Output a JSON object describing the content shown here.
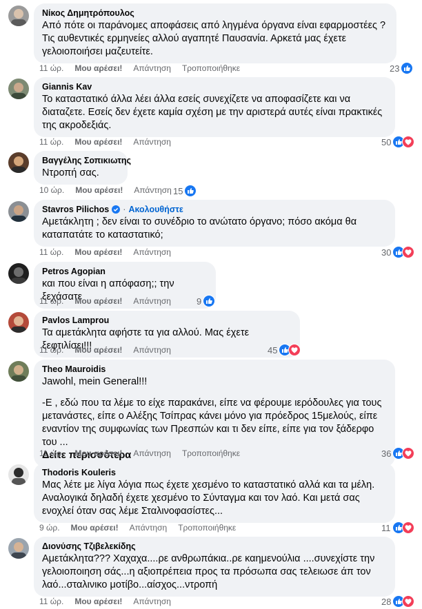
{
  "ui": {
    "like_label": "Μου αρέσει!",
    "reply_label": "Απάντηση",
    "edited_label": "Τροποποιήθηκε",
    "see_more_label": "Δείτε περισσότερα",
    "follow_label": "Ακολουθήστε",
    "dot": "·"
  },
  "comments": [
    {
      "author": "Νίκος Δημητρόπουλος",
      "lines": [
        "Από πότε οι παράνομες αποφάσεις από ληγμένα όργανα είναι εφαρμοστέες ? Τις αυθεντικές ερμηνείες αλλού αγαπητέ Παυσανία. Αρκετά μας έχετε γελοιοποιήσει μαζευτείτε."
      ],
      "time": "11 ώρ.",
      "edited": true,
      "reaction_count": "23",
      "reactions": [
        "like"
      ]
    },
    {
      "author": "Giannis Kav",
      "lines": [
        "Το καταστατικό άλλα λέει άλλα εσείς συνεχίζετε να αποφασίζετε και να διαταζετε. Εσείς δεν έχετε καμία σχέση με την αριστερά αυτές είναι πρακτικές της ακροδεξιάς."
      ],
      "time": "11 ώρ.",
      "edited": false,
      "reaction_count": "50",
      "reactions": [
        "like",
        "love"
      ]
    },
    {
      "author": "Βαγγέλης Σοπικιωτης",
      "lines": [
        "Ντροπή σας."
      ],
      "time": "10 ώρ.",
      "edited": false,
      "reaction_count": "15",
      "reactions": [
        "like"
      ]
    },
    {
      "author": "Stavros Pilichos",
      "verified": true,
      "lines": [
        "Αμετάκλητη ; δεν είναι το συνέδριο το ανώτατο όργανο; πόσο ακόμα θα καταπατάτε το καταστατικό;"
      ],
      "time": "11 ώρ.",
      "edited": false,
      "reaction_count": "30",
      "reactions": [
        "like",
        "love"
      ]
    },
    {
      "author": "Petros Agopian",
      "lines": [
        "και που είναι η απόφαση;; την ξεχάσατε"
      ],
      "time": "11 ώρ.",
      "edited": false,
      "reaction_count": "9",
      "reactions": [
        "like"
      ]
    },
    {
      "author": "Pavlos Lamprou",
      "lines": [
        "Τα αμετάκλητα αφήστε τα για αλλού. Μας έχετε ξεφτιλίσει!!!"
      ],
      "time": "11 ώρ.",
      "edited": false,
      "reaction_count": "45",
      "reactions": [
        "like",
        "love"
      ]
    },
    {
      "author": "Theo Mauroidis",
      "lines": [
        "Jawohl, mein General!!!",
        "-Ε , εδώ που τα λέμε το είχε παρακάνει, είπε να φέρουμε ιερόδουλες για τους μετανάστες, είπε ο Αλέξης Τσίπρας κάνει μόνο για πρόεδρος 15μελούς, είπε εναντίον της συμφωνίας των Πρεσπών και τι δεν είπε, είπε για τον ξάδερφο του ..."
      ],
      "see_more": true,
      "time": "11 ώρ.",
      "edited": true,
      "reaction_count": "36",
      "reactions": [
        "like",
        "love"
      ]
    },
    {
      "author": "Thodoris Kouleris",
      "lines": [
        "Μας λέτε με λίγα λόγια πως έχετε χεσμένο το καταστατικό αλλά και τα μέλη. Αναλογικά δηλαδή έχετε χεσμένο το Σύνταγμα και τον λαό. Και μετά σας ενοχλεί όταν σας λέμε Σταλινοφασίστες..."
      ],
      "time": "9 ώρ.",
      "edited": true,
      "reaction_count": "11",
      "reactions": [
        "like",
        "love"
      ]
    },
    {
      "author": "Διονύσης Τζιβελεκίδης",
      "lines": [
        "Αμετάκλητα??? Χαχαχα....ρε ανθρωπάκια..ρε καημενούλια ....συνεχίστε την γελοιοποιηση σάς...η αξιοπρέπεια προς τα πρόσωπα σας τελειωσε άπ τον λαό...σταλινικο μοτίβο...αίσχος...ντροπή"
      ],
      "time": "11 ώρ.",
      "edited": false,
      "reaction_count": "28",
      "reactions": [
        "like",
        "love"
      ]
    }
  ],
  "colors": {
    "bubble": "#f0f2f5",
    "meta_text": "#65676b",
    "like_blue": "#1877f2",
    "love_red": "#f33e58",
    "follow_blue": "#0064d1"
  },
  "icons": {
    "avatar": "profile-photo",
    "verified": "verified-badge-icon",
    "like": "like-reaction-icon",
    "love": "love-reaction-icon"
  }
}
